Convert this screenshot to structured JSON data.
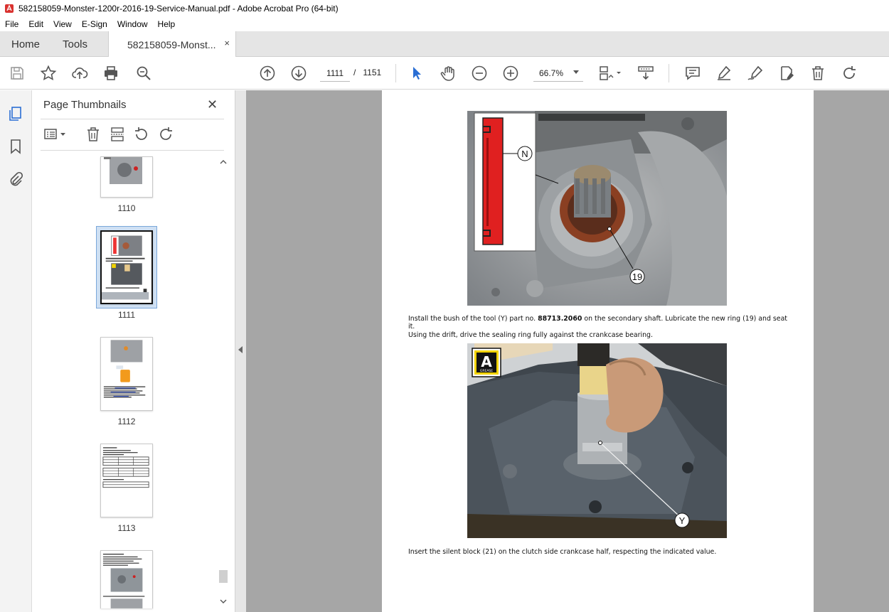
{
  "window": {
    "title": "582158059-Monster-1200r-2016-19-Service-Manual.pdf - Adobe Acrobat Pro (64-bit)"
  },
  "menu": [
    "File",
    "Edit",
    "View",
    "E-Sign",
    "Window",
    "Help"
  ],
  "tabs": {
    "home": "Home",
    "tools": "Tools",
    "document": "582158059-Monst...",
    "close": "×"
  },
  "toolbar": {
    "current_page": "1111",
    "page_separator": "/",
    "total_pages": "1151",
    "zoom": "66.7%"
  },
  "thumbnails_panel": {
    "title": "Page Thumbnails",
    "close": "✕",
    "pages": [
      {
        "label": "1110",
        "selected": false
      },
      {
        "label": "1111",
        "selected": true
      },
      {
        "label": "1112",
        "selected": false
      },
      {
        "label": "1113",
        "selected": false
      },
      {
        "label": "",
        "selected": false
      }
    ]
  },
  "document": {
    "paragraph1_pre": "Install the bush of the tool (Y) part no. ",
    "paragraph1_bold": "88713.2060",
    "paragraph1_post": " on the secondary shaft. Lubricate the new ring (19) and seat it.",
    "paragraph2": "Using the drift, drive the sealing ring fully against the crankcase bearing.",
    "paragraph3": "Insert the silent block (21) on the clutch side crankcase half, respecting the indicated value.",
    "callout_n": "N",
    "callout_19": "19",
    "callout_y": "Y",
    "badge_letter": "A",
    "badge_word": "GREASE"
  }
}
